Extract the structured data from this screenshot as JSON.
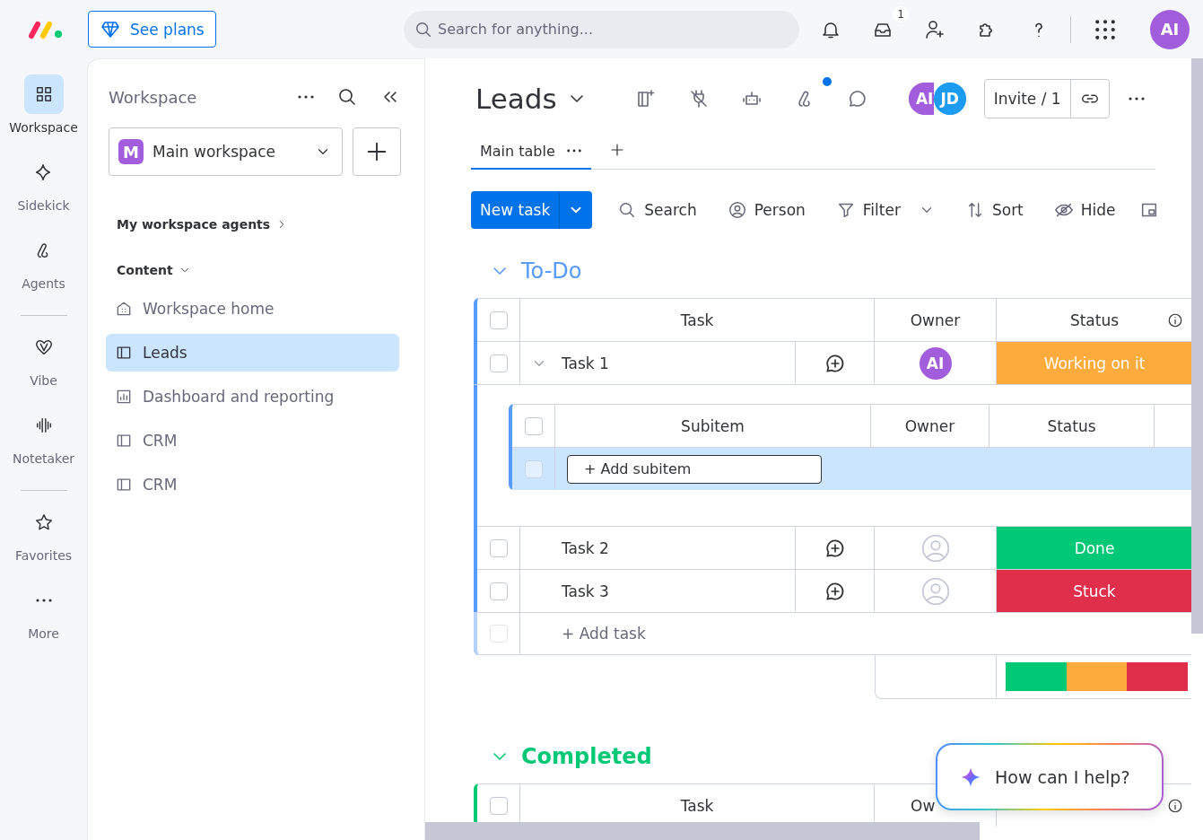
{
  "topbar": {
    "plans_button": "See plans",
    "search": {
      "placeholder": "Search for anything..."
    },
    "inbox_badge": "1",
    "avatar": "AI"
  },
  "rail": [
    [
      {
        "label": "Workspace",
        "selected": true
      },
      {
        "label": "Sidekick",
        "selected": false
      },
      {
        "label": "Agents",
        "selected": false
      }
    ],
    [
      {
        "label": "Vibe",
        "selected": false
      },
      {
        "label": "Notetaker",
        "selected": false
      }
    ],
    [
      {
        "label": "Favorites",
        "selected": false
      },
      {
        "label": "More",
        "selected": false
      }
    ]
  ],
  "workspace_panel": {
    "title": "Workspace",
    "workspace": {
      "initial": "M",
      "name": "Main workspace"
    },
    "agents_link": "My workspace agents",
    "section": {
      "label": "Content",
      "expanded": true
    },
    "items": [
      {
        "kind": "home",
        "label": "Workspace home",
        "selected": false
      },
      {
        "kind": "board",
        "label": "Leads",
        "selected": true
      },
      {
        "kind": "dashboard",
        "label": "Dashboard and reporting",
        "selected": false
      },
      {
        "kind": "board",
        "label": "CRM",
        "selected": false
      },
      {
        "kind": "board",
        "label": "CRM",
        "selected": false
      }
    ]
  },
  "board": {
    "title": "Leads",
    "agents_notification": true,
    "avatars": [
      {
        "initials": "AI",
        "color": "#a25ddc"
      },
      {
        "initials": "JD",
        "color": "#1c9cf0"
      }
    ],
    "invite": "Invite / 1",
    "views": [
      {
        "label": "Main table",
        "selected": true
      }
    ],
    "new_task": "New task",
    "tools": [
      {
        "kind": "search",
        "label": "Search"
      },
      {
        "kind": "person",
        "label": "Person"
      },
      {
        "kind": "filter",
        "label": "Filter"
      },
      {
        "kind": "sort",
        "label": "Sort"
      },
      {
        "kind": "hide",
        "label": "Hide"
      }
    ],
    "groups": [
      {
        "title": "To-Do",
        "color": "#579bfc",
        "expanded": true,
        "header_checked": false,
        "add_checked": false,
        "columns": [
          "Task",
          "Owner",
          "Status"
        ],
        "rows": [
          {
            "task": "Task 1",
            "checked": false,
            "owner": {
              "kind": "avatar",
              "initials": "AI"
            },
            "status": "Working on it",
            "color": "#fdab3d",
            "expanded": true,
            "subitems": {
              "header_checked": false,
              "columns": [
                "Subitem",
                "Owner",
                "Status"
              ],
              "add_checked": false,
              "add": "+ Add subitem"
            }
          },
          {
            "task": "Task 2",
            "checked": false,
            "owner": {
              "kind": "empty"
            },
            "status": "Done",
            "color": "#00c875"
          },
          {
            "task": "Task 3",
            "checked": false,
            "owner": {
              "kind": "empty"
            },
            "status": "Stuck",
            "color": "#df2f4a"
          }
        ],
        "add_task": "+ Add task",
        "summary": [
          {
            "color": "#00c875",
            "level": 0.333
          },
          {
            "color": "#fdab3d",
            "level": 0.667
          },
          {
            "color": "#df2f4a",
            "level": 1
          }
        ]
      },
      {
        "title": "Completed",
        "color": "#00c875",
        "expanded": true,
        "header_checked": false,
        "columns": [
          "Task",
          "Ow"
        ]
      }
    ]
  },
  "assistant": {
    "prompt": "How can I help?"
  }
}
